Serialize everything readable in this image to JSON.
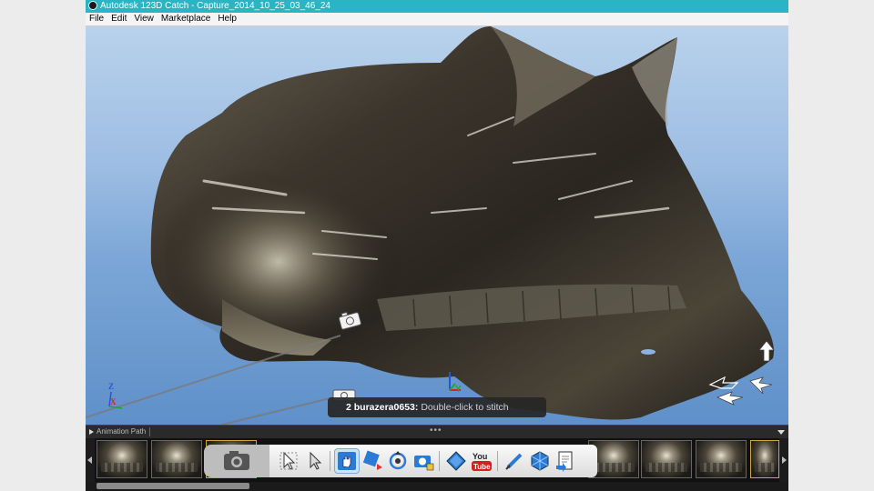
{
  "window": {
    "title": "Autodesk 123D Catch - Capture_2014_10_25_03_46_24"
  },
  "menu": [
    "File",
    "Edit",
    "View",
    "Marketplace",
    "Help"
  ],
  "viewport": {
    "axis_labels": {
      "z": "Z",
      "x": "X",
      "y": "Y"
    },
    "toast": {
      "user": "2 burazera0653:",
      "message": "Double-click to stitch"
    }
  },
  "animation_bar": {
    "label": "Animation Path",
    "dots": "•••"
  },
  "toolbar": {
    "icons": [
      "camera-icon",
      "select-arrow-icon",
      "select-filled-arrow-icon",
      "pan-hand-icon",
      "orbit-icon",
      "rotate-icon",
      "camera-view-icon",
      "cube-icon",
      "youtube-icon",
      "measure-pen-icon",
      "mesh-cube-icon",
      "export-icon"
    ],
    "youtube_label": "You",
    "youtube_label2": "Tube"
  },
  "colors": {
    "titlebar": "#2ab4c4",
    "viewport_sky": "#9dbde3",
    "toast_bg": "#262626"
  }
}
